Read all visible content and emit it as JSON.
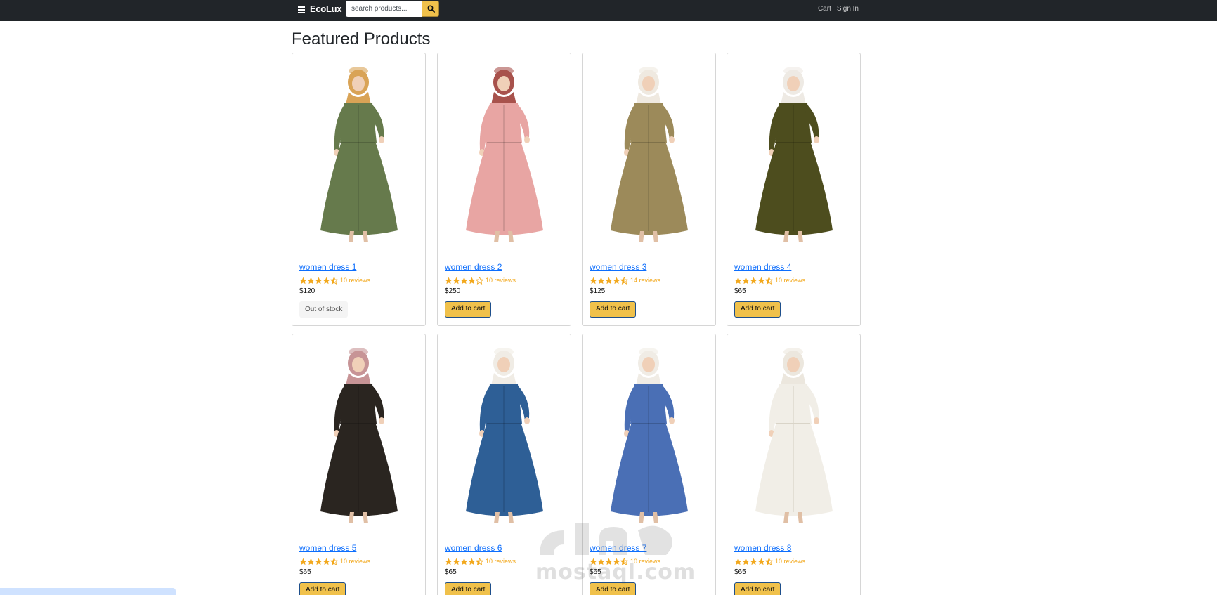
{
  "navbar": {
    "brand": "EcoLux",
    "search_placeholder": "search products...",
    "links": {
      "cart": "Cart",
      "sign_in": "Sign In"
    }
  },
  "page": {
    "title": "Featured Products"
  },
  "colors": {
    "accent": "#f0c14b",
    "link": "#0d6efd",
    "star": "#f2a81c",
    "navbar": "#212529"
  },
  "products": [
    {
      "name": "women dress 1",
      "rating": 4.5,
      "reviews": "10 reviews",
      "price": "$120",
      "action": "Out of stock",
      "in_stock": false,
      "dress_color": "#667a4c",
      "scarf_color": "#d9a356"
    },
    {
      "name": "women dress 2",
      "rating": 4.0,
      "reviews": "10 reviews",
      "price": "$250",
      "action": "Add to cart",
      "in_stock": true,
      "dress_color": "#e8a5a3",
      "scarf_color": "#a8524c"
    },
    {
      "name": "women dress 3",
      "rating": 4.5,
      "reviews": "14 reviews",
      "price": "$125",
      "action": "Add to cart",
      "in_stock": true,
      "dress_color": "#9c8a5a",
      "scarf_color": "#efe9e0"
    },
    {
      "name": "women dress 4",
      "rating": 4.5,
      "reviews": "10 reviews",
      "price": "$65",
      "action": "Add to cart",
      "in_stock": true,
      "dress_color": "#4d4d1e",
      "scarf_color": "#eeeae4"
    },
    {
      "name": "women dress 5",
      "rating": 4.5,
      "reviews": "10 reviews",
      "price": "$65",
      "action": "Add to cart",
      "in_stock": true,
      "dress_color": "#2a2520",
      "scarf_color": "#c79496"
    },
    {
      "name": "women dress 6",
      "rating": 4.5,
      "reviews": "10 reviews",
      "price": "$65",
      "action": "Add to cart",
      "in_stock": true,
      "dress_color": "#2e5f96",
      "scarf_color": "#f0ece5"
    },
    {
      "name": "women dress 7",
      "rating": 4.5,
      "reviews": "10 reviews",
      "price": "$65",
      "action": "Add to cart",
      "in_stock": true,
      "dress_color": "#4a6fb5",
      "scarf_color": "#f0ece5"
    },
    {
      "name": "women dress 8",
      "rating": 4.5,
      "reviews": "10 reviews",
      "price": "$65",
      "action": "Add to cart",
      "in_stock": true,
      "dress_color": "#f1eee7",
      "scarf_color": "#ece7de"
    }
  ],
  "watermark": {
    "text": "mostaql.com"
  }
}
